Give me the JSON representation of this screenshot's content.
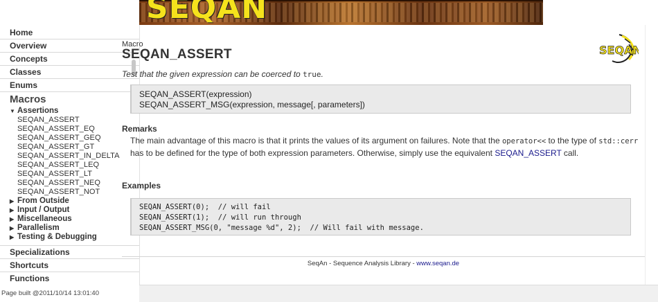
{
  "banner": {
    "logo_text": "SEQAN"
  },
  "sidebar": {
    "nav_top": [
      "Home",
      "Overview",
      "Concepts",
      "Classes",
      "Enums"
    ],
    "section_title": "Macros",
    "assertions_label": "Assertions",
    "assertion_items": [
      "SEQAN_ASSERT",
      "SEQAN_ASSERT_EQ",
      "SEQAN_ASSERT_GEQ",
      "SEQAN_ASSERT_GT",
      "SEQAN_ASSERT_IN_DELTA",
      "SEQAN_ASSERT_LEQ",
      "SEQAN_ASSERT_LT",
      "SEQAN_ASSERT_NEQ",
      "SEQAN_ASSERT_NOT"
    ],
    "collapsed_groups": [
      "From Outside",
      "Input / Output",
      "Miscellaneous",
      "Parallelism",
      "Testing & Debugging"
    ],
    "nav_bottom": [
      "Specializations",
      "Shortcuts",
      "Functions"
    ]
  },
  "page_built": "Page built @2011/10/14 13:01:40",
  "main": {
    "category": "Macro",
    "title": "SEQAN_ASSERT",
    "corner_logo_text": "SEQAN",
    "description_prefix": "Test that the given expression can be coerced to",
    "description_code": "true",
    "description_suffix": ".",
    "signatures": [
      "SEQAN_ASSERT(expression)",
      "SEQAN_ASSERT_MSG(expression, message[, parameters])"
    ],
    "remarks_heading": "Remarks",
    "remarks": {
      "part1": "The main advantage of this macro is that it prints the values of its argument on failures. Note that the",
      "code1": "operator<<",
      "part2": "to the type of",
      "code2": "std::cerr",
      "part3": "has to be defined for the type of both expression parameters. Otherwise, simply use the equivalent",
      "link": "SEQAN_ASSERT",
      "part4": "call."
    },
    "examples_heading": "Examples",
    "examples": [
      "SEQAN_ASSERT(0);  // will fail",
      "SEQAN_ASSERT(1);  // will run through",
      "SEQAN_ASSERT_MSG(0, \"message %d\", 2);  // Will fail with message."
    ]
  },
  "footer": {
    "text": "SeqAn - Sequence Analysis Library -",
    "link": "www.seqan.de"
  },
  "colors": {
    "link": "#1a1a8c",
    "code_bg": "#eaeaea",
    "logo_yellow": "#f5e21c"
  }
}
